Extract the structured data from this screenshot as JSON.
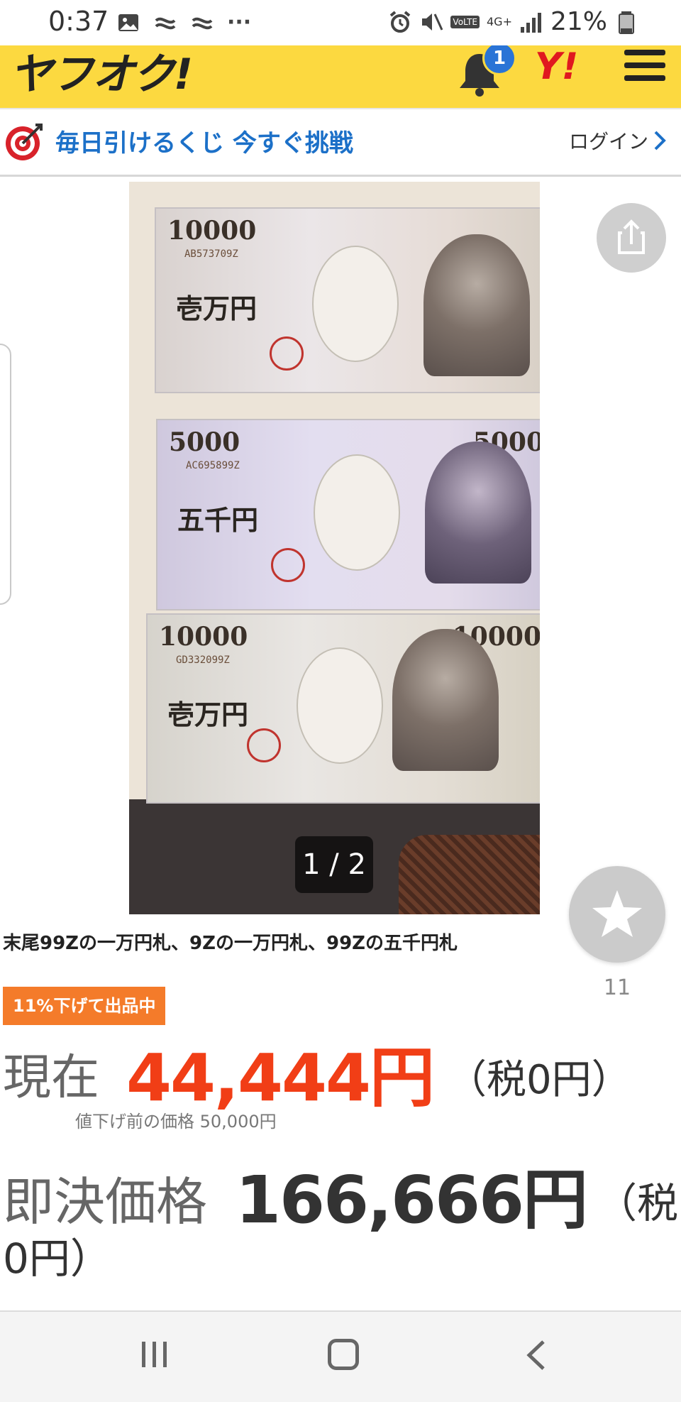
{
  "status_bar": {
    "time": "0:37",
    "battery": "21%",
    "network": "4G+",
    "volte": "VoLTE",
    "more": "···"
  },
  "header": {
    "logo": "ヤフオク!",
    "notification_count": "1",
    "yahoo_logo": "Y!",
    "brand_color": "#fcd940"
  },
  "promo": {
    "text": "毎日引けるくじ 今すぐ挑戦",
    "login": "ログイン"
  },
  "gallery": {
    "counter": "1 / 2",
    "notes": [
      {
        "denom": "10000",
        "kanji": "壱万円",
        "serial": "AB573709Z"
      },
      {
        "denom": "5000",
        "kanji": "五千円",
        "serial": "AC695899Z"
      },
      {
        "denom": "10000",
        "kanji": "壱万円",
        "serial": "GD332099Z"
      }
    ]
  },
  "favorite": {
    "count": "11"
  },
  "item": {
    "title": "末尾99Zの一万円札、9Zの一万円札、99Zの五千円札",
    "discount_tag": "11%下げて出品中",
    "current_label": "現在",
    "current_price": "44,444円",
    "current_tax": "（税0円）",
    "price_before": "値下げ前の価格 50,000円",
    "buyout_label": "即決価格",
    "buyout_price": "166,666円",
    "buyout_tax_1": "（税",
    "buyout_tax_2": "0円）"
  },
  "colors": {
    "price_red": "#f13e16",
    "tag_orange": "#f47b2a",
    "link_blue": "#1c70c8"
  }
}
